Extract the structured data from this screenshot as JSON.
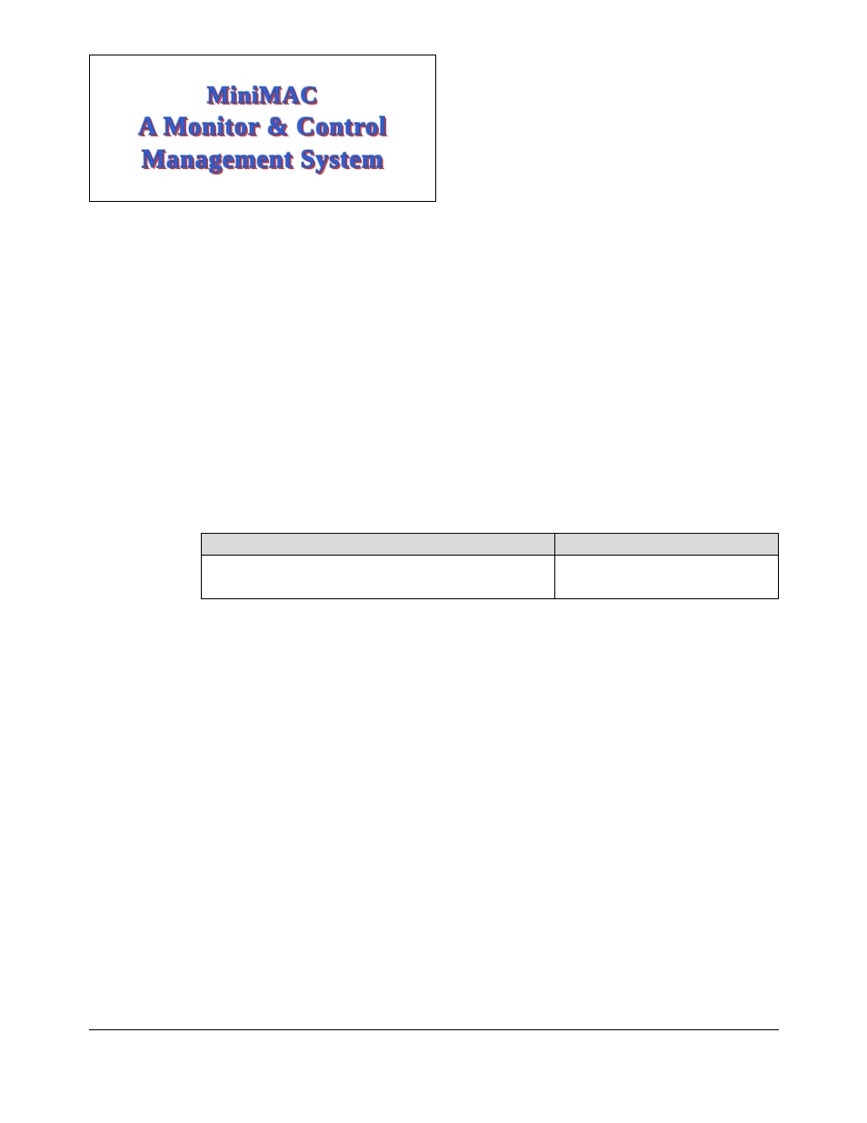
{
  "logo": {
    "line1": "MiniMAC",
    "line2": "A Monitor & Control",
    "line3": "Management System"
  },
  "table": {
    "headers": [
      "",
      ""
    ],
    "rows": [
      [
        "",
        ""
      ]
    ]
  }
}
